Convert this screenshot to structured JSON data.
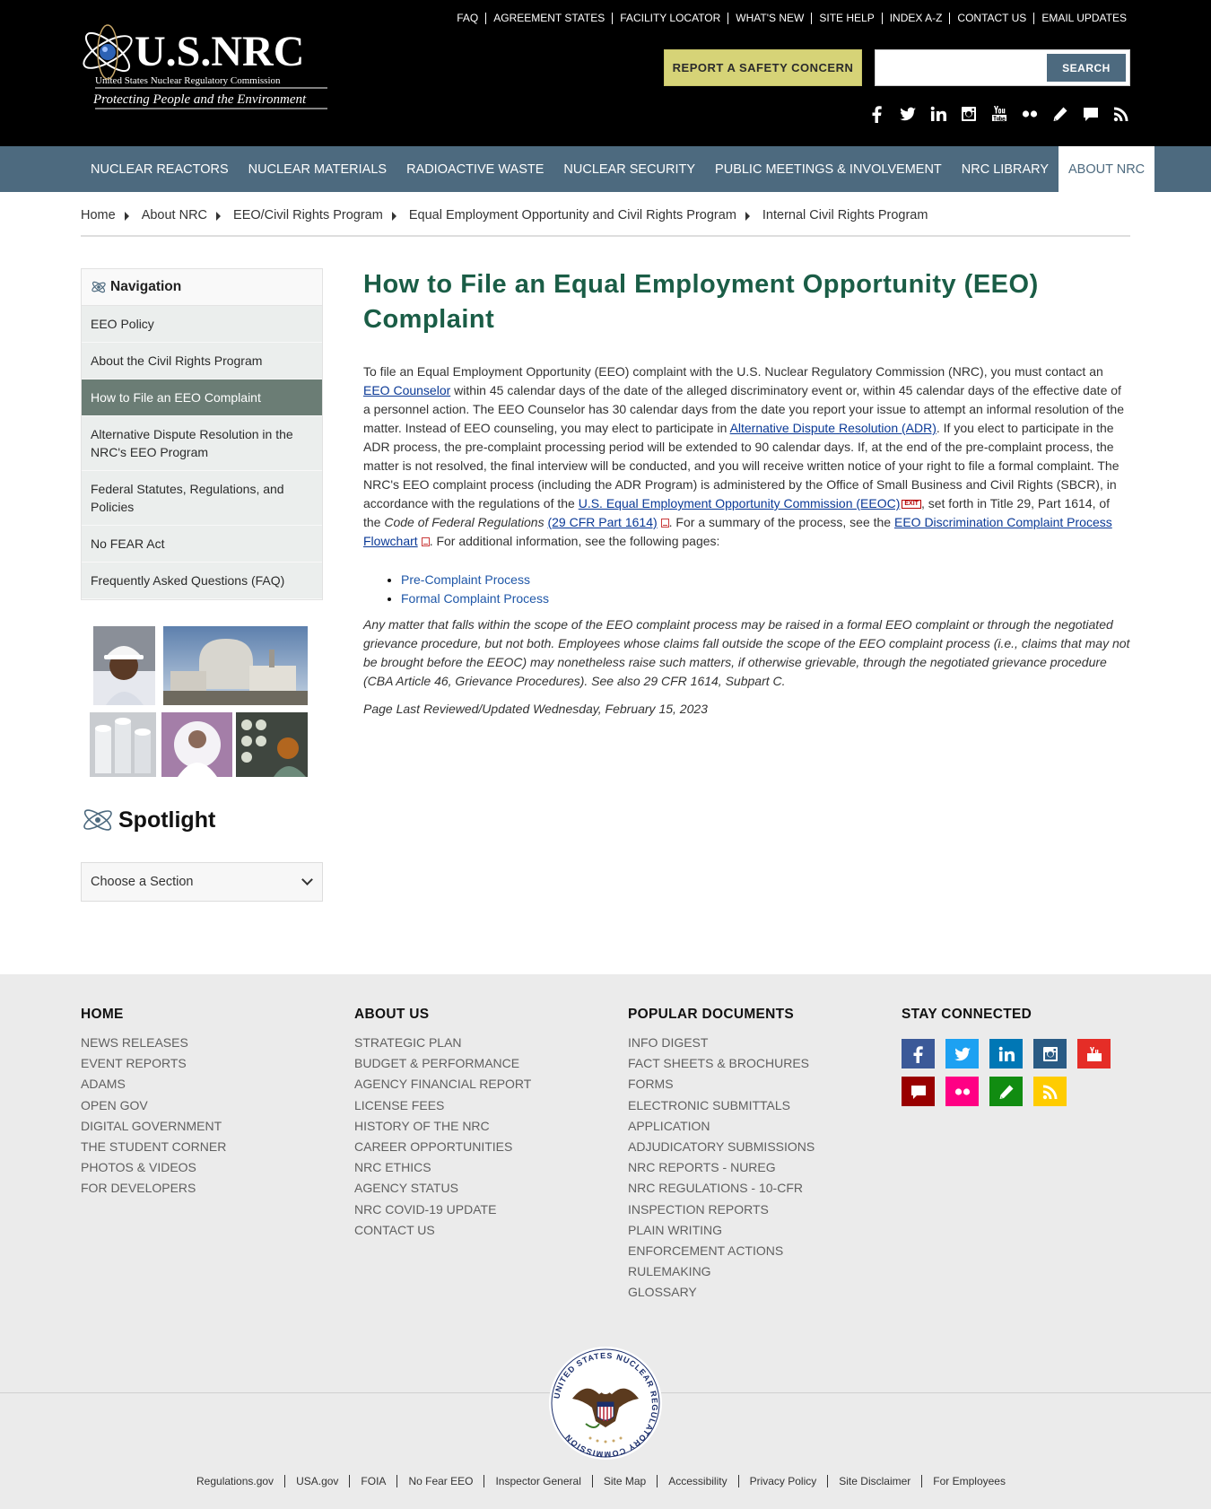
{
  "header": {
    "logo_title": "U.S.NRC",
    "logo_subtitle": "United States Nuclear Regulatory Commission",
    "logo_tagline": "Protecting People and the Environment",
    "utility_links": [
      "FAQ",
      "AGREEMENT STATES",
      "FACILITY LOCATOR",
      "WHAT'S NEW",
      "SITE HELP",
      "INDEX A-Z",
      "CONTACT US",
      "EMAIL UPDATES"
    ],
    "report_button": "REPORT A SAFETY CONCERN",
    "search_placeholder": "",
    "search_button": "SEARCH",
    "social_icons": [
      "facebook-icon",
      "twitter-icon",
      "linkedin-icon",
      "instagram-icon",
      "youtube-icon",
      "flickr-icon",
      "blog-icon",
      "comment-icon",
      "rss-icon"
    ]
  },
  "main_nav": [
    "NUCLEAR REACTORS",
    "NUCLEAR MATERIALS",
    "RADIOACTIVE WASTE",
    "NUCLEAR SECURITY",
    "PUBLIC MEETINGS & INVOLVEMENT",
    "NRC LIBRARY",
    "ABOUT NRC"
  ],
  "main_nav_active": "ABOUT NRC",
  "breadcrumb": [
    "Home",
    "About NRC",
    "EEO/Civil Rights Program",
    "Equal Employment Opportunity and Civil Rights Program",
    "Internal Civil Rights Program"
  ],
  "sidebar": {
    "title": "Navigation",
    "items": [
      "EEO Policy",
      "About the Civil Rights Program",
      "How to File an EEO Complaint",
      "Alternative Dispute Resolution in the NRC's EEO Program",
      "Federal Statutes, Regulations, and Policies",
      "No FEAR Act",
      "Frequently Asked Questions (FAQ)"
    ],
    "active_index": 2,
    "spotlight_title": "Spotlight",
    "spotlight_select": "Choose a Section"
  },
  "content": {
    "title": "How to File an Equal Employment Opportunity (EEO) Complaint",
    "p1_a": "To file an Equal Employment Opportunity (EEO) complaint with the U.S. Nuclear Regulatory Commission (NRC), you must contact an ",
    "p1_link1": "EEO Counselor",
    "p1_b": " within 45 calendar days of the date of the alleged discriminatory event or, within 45 calendar days of the effective date of a personnel action. The EEO Counselor has 30 calendar days from the date you report your issue to attempt an informal resolution of the matter. Instead of EEO counseling, you may elect to participate in ",
    "p1_link2": "Alternative Dispute Resolution (ADR)",
    "p1_c": ". If you elect to participate in the ADR process, the pre-complaint processing period will be extended to 90 calendar days. If, at the end of the pre-complaint process, the matter is not resolved, the final interview will be conducted, and you will receive written notice of your right to file a formal complaint. The NRC's EEO complaint process (including the ADR Program) is administered by the Office of Small Business and Civil Rights (SBCR), in accordance with the regulations of the ",
    "p1_link3": "U.S. Equal Employment Opportunity Commission (EEOC)",
    "exit_label": "EXIT",
    "p1_d": ", set forth in Title 29, Part 1614, of the ",
    "p1_cfr": "Code of Federal Regulations",
    "p1_link4": "(29 CFR Part 1614)",
    "p1_e": ". For a summary of the process, see the ",
    "p1_link5": "EEO Discrimination Complaint Process Flowchart",
    "p1_f": ". For additional information, see the following pages:",
    "list": [
      "Pre-Complaint Process",
      "Formal Complaint Process"
    ],
    "p2": "Any matter that falls within the scope of the EEO complaint process may be raised in a formal EEO complaint or through the negotiated grievance procedure, but not both. Employees whose claims fall outside the scope of the EEO complaint process (i.e., claims that may not be brought before the EEOC) may nonetheless raise such matters, if otherwise grievable, through the negotiated grievance procedure (CBA Article 46, Grievance Procedures). See also 29 CFR 1614, Subpart C.",
    "p3": "Page Last Reviewed/Updated Wednesday, February 15, 2023"
  },
  "footer": {
    "col1": {
      "title": "HOME",
      "items": [
        "NEWS RELEASES",
        "EVENT REPORTS",
        "ADAMS",
        "OPEN GOV",
        "DIGITAL GOVERNMENT",
        "THE STUDENT CORNER",
        "PHOTOS & VIDEOS",
        "FOR DEVELOPERS"
      ]
    },
    "col2": {
      "title": "ABOUT US",
      "items": [
        "STRATEGIC PLAN",
        "BUDGET & PERFORMANCE",
        "AGENCY FINANCIAL REPORT",
        "LICENSE FEES",
        "HISTORY OF THE NRC",
        "CAREER OPPORTUNITIES",
        "NRC ETHICS",
        "AGENCY STATUS",
        "NRC COVID-19 UPDATE",
        "CONTACT US"
      ]
    },
    "col3": {
      "title": "POPULAR DOCUMENTS",
      "items": [
        "INFO DIGEST",
        "FACT SHEETS & BROCHURES",
        "FORMS",
        "ELECTRONIC SUBMITTALS",
        "APPLICATION",
        "ADJUDICATORY SUBMISSIONS",
        "NRC REPORTS - NUREG",
        "NRC REGULATIONS - 10-CFR",
        "INSPECTION REPORTS",
        "PLAIN WRITING",
        "ENFORCEMENT ACTIONS",
        "RULEMAKING",
        "GLOSSARY"
      ]
    },
    "col4": {
      "title": "STAY CONNECTED"
    },
    "stay_colors": {
      "facebook": "#3b5998",
      "twitter": "#1da1f2",
      "linkedin": "#0077b5",
      "instagram": "#2a5b84",
      "youtube": "#e52d27",
      "comment": "#990000",
      "flickr": "#ff0084",
      "blog": "#118c11",
      "rss": "#ffcc00"
    },
    "seal_text": "UNITED STATES NUCLEAR REGULATORY COMMISSION",
    "bottom_links": [
      "Regulations.gov",
      "USA.gov",
      "FOIA",
      "No Fear EEO",
      "Inspector General",
      "Site Map",
      "Accessibility",
      "Privacy Policy",
      "Site Disclaimer",
      "For Employees"
    ]
  }
}
